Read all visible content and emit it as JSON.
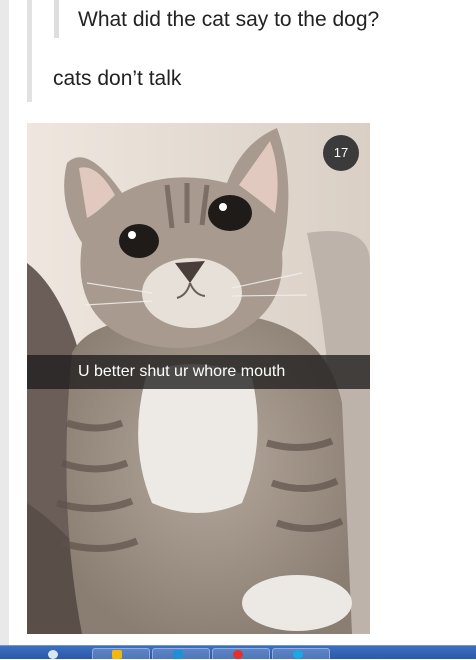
{
  "post": {
    "question": "What did the cat say to the dog?",
    "answer": "cats don’t talk"
  },
  "snap": {
    "timer": "17",
    "caption": "U better shut ur whore mouth"
  },
  "taskbar": {
    "icons": [
      "start-orb-icon",
      "folder-icon",
      "media-player-icon",
      "browser-icon",
      "skype-icon"
    ],
    "colors": {
      "bar": "#2f62b4",
      "folder": "#f2b80c",
      "media": "#1f8fd6",
      "browser": "#e4312b",
      "skype": "#19a9e8"
    }
  }
}
